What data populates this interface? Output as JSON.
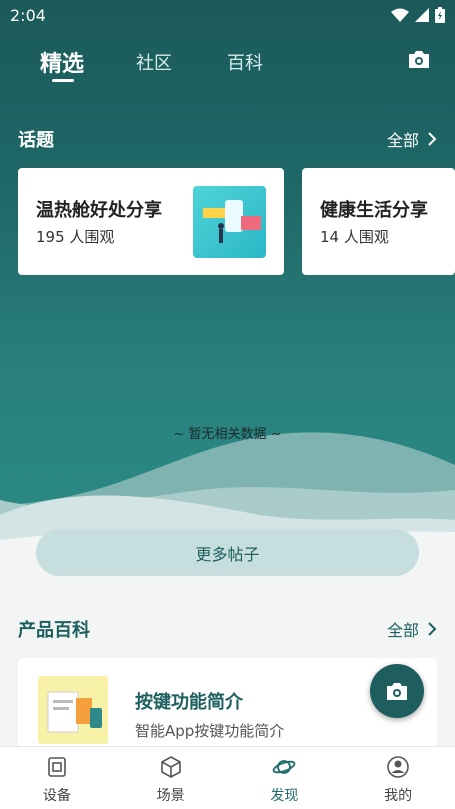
{
  "status": {
    "time": "2:04"
  },
  "top_tabs": [
    {
      "label": "精选",
      "active": true
    },
    {
      "label": "社区",
      "active": false
    },
    {
      "label": "百科",
      "active": false
    }
  ],
  "topics": {
    "title": "话题",
    "more_label": "全部",
    "cards": [
      {
        "name": "温热舱好处分享",
        "views": "195 人围观"
      },
      {
        "name": "健康生活分享",
        "views": "14 人围观"
      }
    ]
  },
  "empty_note": "~ 暂无相关数据 ~",
  "more_posts_label": "更多帖子",
  "products": {
    "title": "产品百科",
    "more_label": "全部",
    "items": [
      {
        "name": "按键功能简介",
        "desc": "智能App按键功能简介"
      }
    ]
  },
  "bottom_nav": [
    {
      "label": "设备",
      "icon": "device-icon",
      "active": false
    },
    {
      "label": "场景",
      "icon": "scene-icon",
      "active": false
    },
    {
      "label": "发现",
      "icon": "discover-icon",
      "active": true
    },
    {
      "label": "我的",
      "icon": "profile-icon",
      "active": false
    }
  ],
  "colors": {
    "primary": "#1f5e5e",
    "hero_top": "#1b5a5a",
    "hero_bottom": "#2b8a84",
    "button_bg": "#c7dede"
  }
}
